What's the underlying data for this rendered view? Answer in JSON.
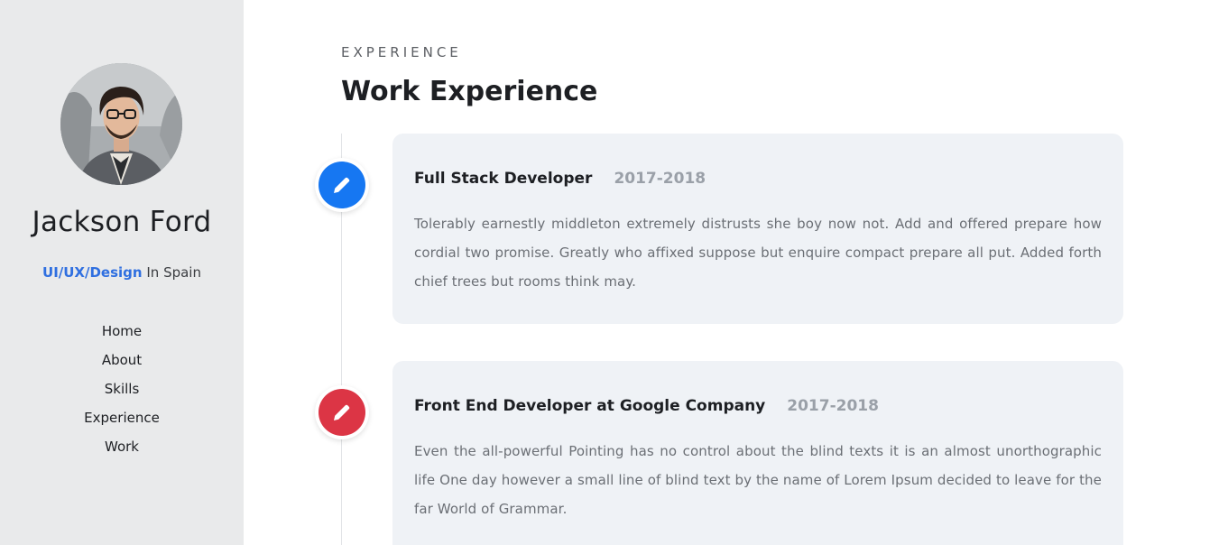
{
  "profile": {
    "name": "Jackson Ford",
    "role": "UI/UX/Design",
    "location": "In Spain"
  },
  "nav": {
    "items": [
      {
        "label": "Home"
      },
      {
        "label": "About"
      },
      {
        "label": "Skills"
      },
      {
        "label": "Experience"
      },
      {
        "label": "Work"
      }
    ]
  },
  "section": {
    "label": "EXPERIENCE",
    "title": "Work Experience"
  },
  "experience": [
    {
      "title": "Full Stack Developer",
      "years": "2017-2018",
      "description": "Tolerably earnestly middleton extremely distrusts she boy now not. Add and offered prepare how cordial two promise. Greatly who affixed suppose but enquire compact prepare all put. Added forth chief trees but rooms think may.",
      "icon": "pencil-icon",
      "color": "#1677f2"
    },
    {
      "title": "Front End Developer at Google Company",
      "years": "2017-2018",
      "description": "Even the all-powerful Pointing has no control about the blind texts it is an almost unorthographic life One day however a small line of blind text by the name of Lorem Ipsum decided to leave for the far World of Grammar.",
      "icon": "pencil-icon",
      "color": "#dc3545"
    }
  ]
}
